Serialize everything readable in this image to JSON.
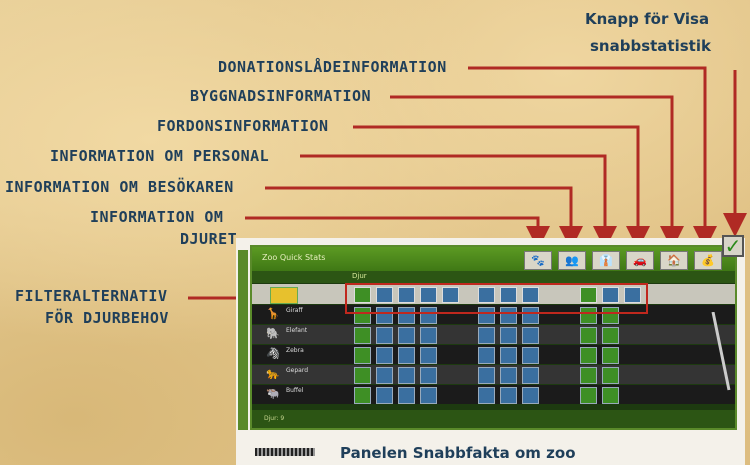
{
  "labels": {
    "quick_stats_button": "Knapp för Visa snabbstatistik",
    "quick_stats_line1": "Knapp för Visa",
    "quick_stats_line2": "snabbstatistik",
    "donation_box": "Donationslådeinformation",
    "building": "Byggnadsinformation",
    "vehicle": "Fordonsinformation",
    "staff": "Information om personal",
    "visitor": "Information om besökaren",
    "animal_line1": "Information om",
    "animal_line2": "djuret",
    "filter_line1": "Filteralternativ",
    "filter_line2": "för djurbehov"
  },
  "caption": "Panelen Snabbfakta om zoo",
  "panel": {
    "title": "Zoo Quick Stats",
    "header_text": "Djur",
    "footer_text": "Djur: 9",
    "tabs": [
      "🐾",
      "👥",
      "👔",
      "🚗",
      "🏠",
      "💰"
    ],
    "rows": [
      {
        "icon": "🦒",
        "name": "Giraff"
      },
      {
        "icon": "🐘",
        "name": "Elefant"
      },
      {
        "icon": "🦓",
        "name": "Zebra"
      },
      {
        "icon": "🐆",
        "name": "Gepard"
      },
      {
        "icon": "🐃",
        "name": "Buffel"
      }
    ]
  },
  "colors": {
    "label": "#1f3f5a",
    "arrow": "#b02a24",
    "panel_green": "#3f7815",
    "highlight": "#c0281e"
  }
}
